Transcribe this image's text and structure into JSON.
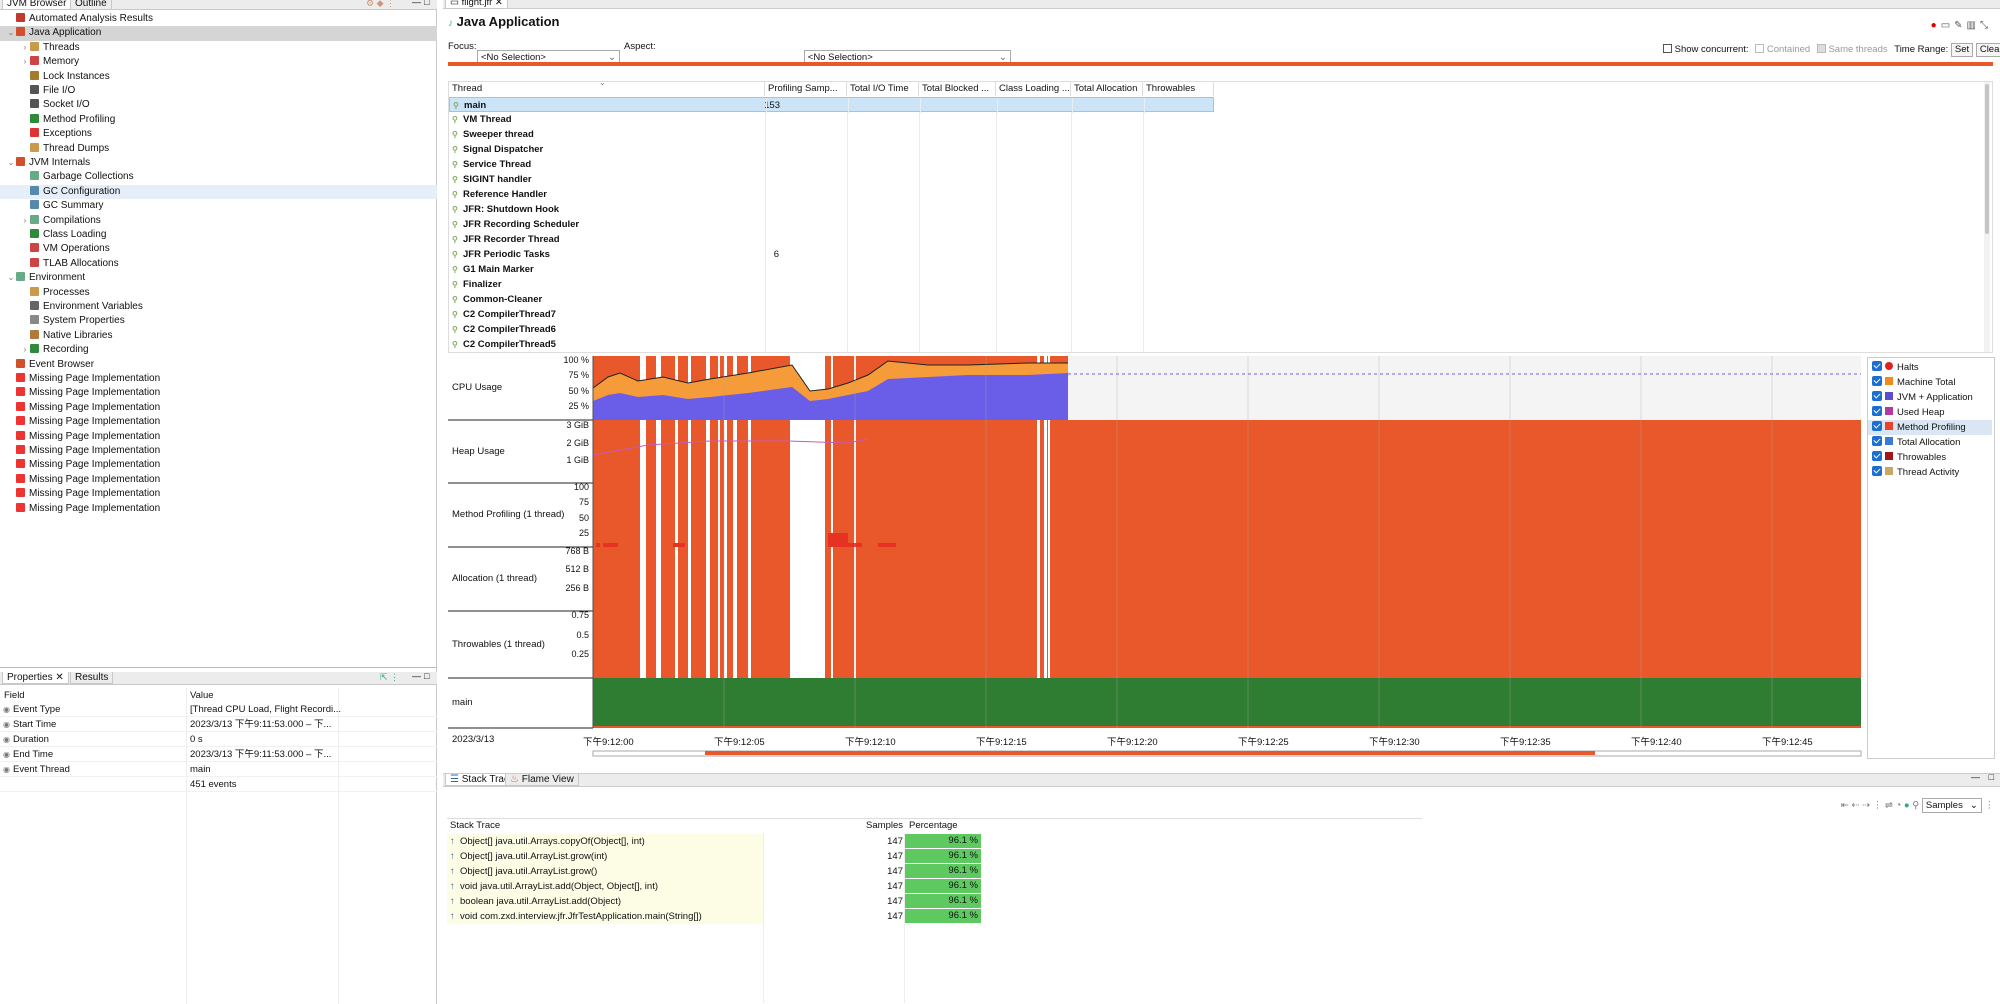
{
  "left_tabs": {
    "jvm_browser": "JVM Browser",
    "outline": "Outline"
  },
  "tree": [
    {
      "label": "Automated Analysis Results",
      "depth": 0,
      "tw": "",
      "color": "#c0392b"
    },
    {
      "label": "Java Application",
      "depth": 0,
      "tw": "⌄",
      "color": "#d0502d",
      "selected": true
    },
    {
      "label": "Threads",
      "depth": 1,
      "tw": "›",
      "color": "#c89b4a"
    },
    {
      "label": "Memory",
      "depth": 1,
      "tw": "›",
      "color": "#c44"
    },
    {
      "label": "Lock Instances",
      "depth": 1,
      "tw": "",
      "color": "#a47a2b"
    },
    {
      "label": "File I/O",
      "depth": 1,
      "tw": "",
      "color": "#555"
    },
    {
      "label": "Socket I/O",
      "depth": 1,
      "tw": "",
      "color": "#555"
    },
    {
      "label": "Method Profiling",
      "depth": 1,
      "tw": "",
      "color": "#2e8b3a"
    },
    {
      "label": "Exceptions",
      "depth": 1,
      "tw": "",
      "color": "#d33"
    },
    {
      "label": "Thread Dumps",
      "depth": 1,
      "tw": "",
      "color": "#c89b4a"
    },
    {
      "label": "JVM Internals",
      "depth": 0,
      "tw": "⌄",
      "color": "#d0502d"
    },
    {
      "label": "Garbage Collections",
      "depth": 1,
      "tw": "",
      "color": "#6a8"
    },
    {
      "label": "GC Configuration",
      "depth": 1,
      "tw": "",
      "color": "#58a",
      "hover": true
    },
    {
      "label": "GC Summary",
      "depth": 1,
      "tw": "",
      "color": "#58a"
    },
    {
      "label": "Compilations",
      "depth": 1,
      "tw": "›",
      "color": "#6a8"
    },
    {
      "label": "Class Loading",
      "depth": 1,
      "tw": "",
      "color": "#2e8b3a"
    },
    {
      "label": "VM Operations",
      "depth": 1,
      "tw": "",
      "color": "#c44"
    },
    {
      "label": "TLAB Allocations",
      "depth": 1,
      "tw": "",
      "color": "#c44"
    },
    {
      "label": "Environment",
      "depth": 0,
      "tw": "⌄",
      "color": "#6a8"
    },
    {
      "label": "Processes",
      "depth": 1,
      "tw": "",
      "color": "#c89b4a"
    },
    {
      "label": "Environment Variables",
      "depth": 1,
      "tw": "",
      "color": "#666"
    },
    {
      "label": "System Properties",
      "depth": 1,
      "tw": "",
      "color": "#888"
    },
    {
      "label": "Native Libraries",
      "depth": 1,
      "tw": "",
      "color": "#b07a3a"
    },
    {
      "label": "Recording",
      "depth": 1,
      "tw": "›",
      "color": "#2e8b3a"
    },
    {
      "label": "Event Browser",
      "depth": 0,
      "tw": "",
      "color": "#d0502d"
    },
    {
      "label": "Missing Page Implementation",
      "depth": 0,
      "tw": "",
      "color": "#e33"
    },
    {
      "label": "Missing Page Implementation",
      "depth": 0,
      "tw": "",
      "color": "#e33"
    },
    {
      "label": "Missing Page Implementation",
      "depth": 0,
      "tw": "",
      "color": "#e33"
    },
    {
      "label": "Missing Page Implementation",
      "depth": 0,
      "tw": "",
      "color": "#e33"
    },
    {
      "label": "Missing Page Implementation",
      "depth": 0,
      "tw": "",
      "color": "#e33"
    },
    {
      "label": "Missing Page Implementation",
      "depth": 0,
      "tw": "",
      "color": "#e33"
    },
    {
      "label": "Missing Page Implementation",
      "depth": 0,
      "tw": "",
      "color": "#e33"
    },
    {
      "label": "Missing Page Implementation",
      "depth": 0,
      "tw": "",
      "color": "#e33"
    },
    {
      "label": "Missing Page Implementation",
      "depth": 0,
      "tw": "",
      "color": "#e33"
    },
    {
      "label": "Missing Page Implementation",
      "depth": 0,
      "tw": "",
      "color": "#e33"
    }
  ],
  "props": {
    "tabs": {
      "properties": "Properties",
      "results": "Results"
    },
    "headers": {
      "field": "Field",
      "value": "Value"
    },
    "rows": [
      {
        "field": "Event Type",
        "value": "[Thread CPU Load, Flight Recordi..."
      },
      {
        "field": "Start Time",
        "value": "2023/3/13 下午9:11:53.000 – 下..."
      },
      {
        "field": "Duration",
        "value": "0 s"
      },
      {
        "field": "End Time",
        "value": "2023/3/13 下午9:11:53.000 – 下..."
      },
      {
        "field": "Event Thread",
        "value": "main"
      },
      {
        "field": "",
        "value": "451 events"
      }
    ]
  },
  "editor": {
    "tab": "flight.jfr",
    "title": "Java Application",
    "focus_label": "Focus:",
    "focus_value": "<No Selection>",
    "aspect_label": "Aspect:",
    "aspect_value": "<No Selection>",
    "show_concurrent": "Show concurrent:",
    "contained": "Contained",
    "same_threads": "Same threads",
    "time_range": "Time Range:",
    "set": "Set",
    "clear": "Clear"
  },
  "thread_table": {
    "columns": [
      "Thread",
      "Profiling Samp...",
      "Total I/O Time",
      "Total Blocked ...",
      "Class Loading ...",
      "Total Allocation",
      "Throwables"
    ],
    "rows": [
      {
        "name": "main",
        "samples": "153"
      },
      {
        "name": "VM Thread",
        "samples": ""
      },
      {
        "name": "Sweeper thread",
        "samples": ""
      },
      {
        "name": "Signal Dispatcher",
        "samples": ""
      },
      {
        "name": "Service Thread",
        "samples": ""
      },
      {
        "name": "SIGINT handler",
        "samples": ""
      },
      {
        "name": "Reference Handler",
        "samples": ""
      },
      {
        "name": "JFR: Shutdown Hook",
        "samples": ""
      },
      {
        "name": "JFR Recording Scheduler",
        "samples": ""
      },
      {
        "name": "JFR Recorder Thread",
        "samples": ""
      },
      {
        "name": "JFR Periodic Tasks",
        "samples": "6"
      },
      {
        "name": "G1 Main Marker",
        "samples": ""
      },
      {
        "name": "Finalizer",
        "samples": ""
      },
      {
        "name": "Common-Cleaner",
        "samples": ""
      },
      {
        "name": "C2 CompilerThread7",
        "samples": ""
      },
      {
        "name": "C2 CompilerThread6",
        "samples": ""
      },
      {
        "name": "C2 CompilerThread5",
        "samples": ""
      }
    ]
  },
  "lanes": [
    {
      "label": "CPU Usage",
      "ticks": [
        "100 %",
        "75 %",
        "50 %",
        "25 %"
      ]
    },
    {
      "label": "Heap Usage",
      "ticks": [
        "3 GiB",
        "2 GiB",
        "1 GiB"
      ]
    },
    {
      "label": "Method Profiling (1 thread)",
      "ticks": [
        "100",
        "75",
        "50",
        "25"
      ]
    },
    {
      "label": "Allocation (1 thread)",
      "ticks": [
        "768 B",
        "512 B",
        "256 B"
      ]
    },
    {
      "label": "Throwables (1 thread)",
      "ticks": [
        "0.75",
        "0.5",
        "0.25"
      ]
    },
    {
      "label": "main",
      "ticks": []
    }
  ],
  "time_axis": {
    "date": "2023/3/13",
    "ticks": [
      "下午9:12:00",
      "下午9:12:05",
      "下午9:12:10",
      "下午9:12:15",
      "下午9:12:20",
      "下午9:12:25",
      "下午9:12:30",
      "下午9:12:35",
      "下午9:12:40",
      "下午9:12:45"
    ]
  },
  "legend": [
    {
      "label": "Halts",
      "color": "#d22"
    },
    {
      "label": "Machine Total",
      "color": "#f08a1c"
    },
    {
      "label": "JVM + Application",
      "color": "#5a4fd0"
    },
    {
      "label": "Used Heap",
      "color": "#b03aa0"
    },
    {
      "label": "Method Profiling",
      "color": "#e8442a",
      "selected": true
    },
    {
      "label": "Total Allocation",
      "color": "#3a7bd5"
    },
    {
      "label": "Throwables",
      "color": "#a01818"
    },
    {
      "label": "Thread Activity",
      "color": "#c8a86a"
    }
  ],
  "bottom": {
    "tabs": {
      "stack_trace": "Stack Trace",
      "flame_view": "Flame View"
    },
    "samples_select": "Samples",
    "headers": {
      "stack": "Stack Trace",
      "samples": "Samples",
      "pct": "Percentage"
    },
    "rows": [
      {
        "frame": "Object[] java.util.Arrays.copyOf(Object[], int)",
        "samples": "147",
        "pct": "96.1 %"
      },
      {
        "frame": "Object[] java.util.ArrayList.grow(int)",
        "samples": "147",
        "pct": "96.1 %"
      },
      {
        "frame": "Object[] java.util.ArrayList.grow()",
        "samples": "147",
        "pct": "96.1 %"
      },
      {
        "frame": "void java.util.ArrayList.add(Object, Object[], int)",
        "samples": "147",
        "pct": "96.1 %"
      },
      {
        "frame": "boolean java.util.ArrayList.add(Object)",
        "samples": "147",
        "pct": "96.1 %"
      },
      {
        "frame": "void com.zxd.interview.jfr.JfrTestApplication.main(String[])",
        "samples": "147",
        "pct": "96.1 %"
      }
    ]
  },
  "colors": {
    "accent_orange": "#e8582a",
    "machine": "#f59b3a",
    "jvm": "#6a5ee8",
    "thread_green": "#2f7d32",
    "pct_green": "#5ec960",
    "selection": "#cce4f7"
  }
}
